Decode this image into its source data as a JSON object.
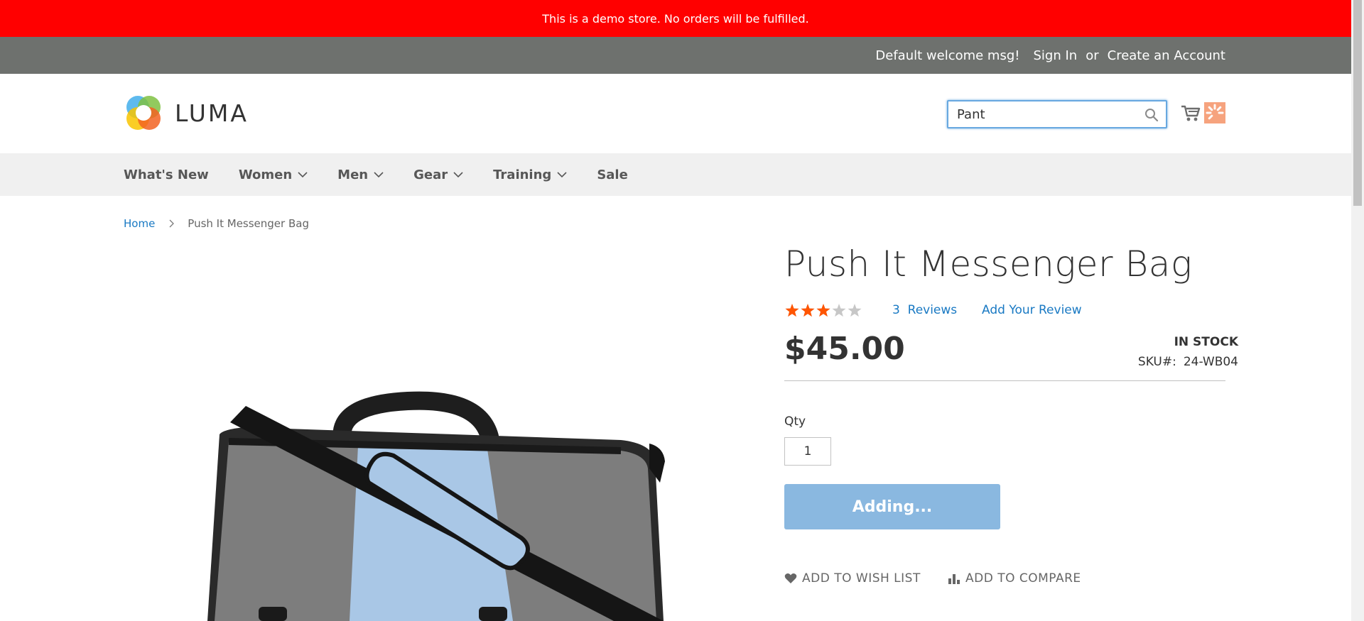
{
  "demo_notice": "This is a demo store. No orders will be fulfilled.",
  "header_panel": {
    "welcome": "Default welcome msg!",
    "sign_in": "Sign In",
    "or": "or",
    "create_account": "Create an Account"
  },
  "logo": {
    "text": "LUMA"
  },
  "search": {
    "value": "Pant",
    "icon": "search-icon"
  },
  "cart": {
    "icon": "shopping-cart-icon",
    "loading": true
  },
  "nav": {
    "items": [
      {
        "label": "What's New",
        "has_submenu": false
      },
      {
        "label": "Women",
        "has_submenu": true
      },
      {
        "label": "Men",
        "has_submenu": true
      },
      {
        "label": "Gear",
        "has_submenu": true
      },
      {
        "label": "Training",
        "has_submenu": true
      },
      {
        "label": "Sale",
        "has_submenu": false
      }
    ]
  },
  "breadcrumb": {
    "home": "Home",
    "current": "Push It Messenger Bag"
  },
  "product": {
    "title": "Push It Messenger Bag",
    "rating_fraction": 0.6,
    "reviews_count": "3",
    "reviews_label": "Reviews",
    "add_review": "Add Your Review",
    "price": "$45.00",
    "stock": "IN STOCK",
    "sku_label": "SKU#:",
    "sku_value": "24-WB04",
    "qty_label": "Qty",
    "qty_value": "1",
    "add_button": "Adding...",
    "wishlist": "ADD TO WISH LIST",
    "compare": "ADD TO COMPARE"
  },
  "colors": {
    "demo_banner": "#ff0000",
    "header_panel": "#6e716e",
    "link": "#1979c3",
    "star": "#ff5501",
    "button_disabled": "#8ab8e0"
  }
}
